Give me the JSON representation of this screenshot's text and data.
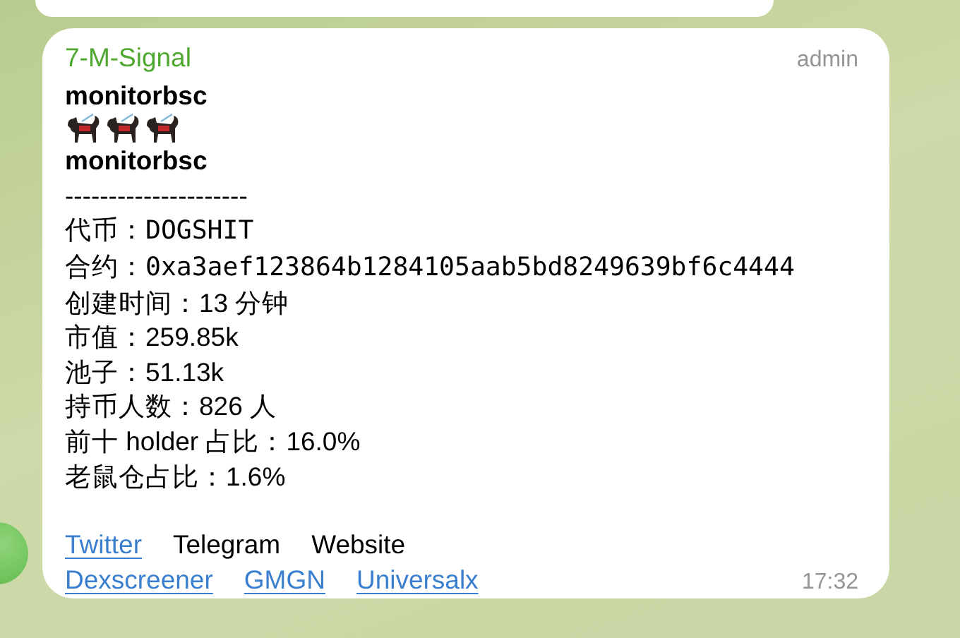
{
  "message": {
    "sender": "7-M-Signal",
    "role": "admin",
    "headline": "monitorbsc",
    "subtitle": "monitorbsc",
    "divider": "---------------------",
    "fields": [
      {
        "label": "代币：",
        "value": "DOGSHIT",
        "kind": "mono"
      },
      {
        "label": "合约：",
        "value": "0xa3aef123864b1284105aab5bd8249639bf6c4444",
        "kind": "mono"
      },
      {
        "label": "创建时间：",
        "value": "13 分钟",
        "kind": "text"
      },
      {
        "label": "市值：",
        "value": "259.85k",
        "kind": "text"
      },
      {
        "label": "池子：",
        "value": "51.13k",
        "kind": "text"
      },
      {
        "label": "持币人数：",
        "value": "826 人",
        "kind": "text"
      },
      {
        "label": "前十 holder 占比：",
        "value": "16.0%",
        "kind": "text"
      },
      {
        "label": "老鼠仓占比：",
        "value": "1.6%",
        "kind": "text"
      }
    ],
    "link_rows": [
      [
        {
          "text": "Twitter",
          "link": true
        },
        {
          "text": "Telegram",
          "link": false
        },
        {
          "text": "Website",
          "link": false
        }
      ],
      [
        {
          "text": "Dexscreener",
          "link": true
        },
        {
          "text": "GMGN",
          "link": true
        },
        {
          "text": "Universalx",
          "link": true
        }
      ]
    ],
    "time": "17:32"
  }
}
